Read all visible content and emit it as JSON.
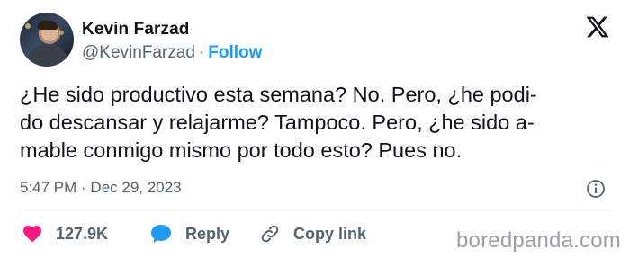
{
  "author": {
    "name": "Kevin Farzad",
    "handle": "@KevinFarzad",
    "separator": "·",
    "follow_label": "Follow"
  },
  "tweet": {
    "text": "¿He sido productivo esta semana? No. Pero, ¿he podi-\ndo descansar y relajarme? Tampoco. Pero, ¿he sido a-\nmable conmigo mismo por todo esto? Pues no.",
    "timestamp": "5:47 PM · Dec 29, 2023"
  },
  "actions": {
    "likes_count": "127.9K",
    "reply_label": "Reply",
    "copy_link_label": "Copy link"
  },
  "icons": {
    "platform_logo": "x-logo-icon",
    "info": "info-icon",
    "like": "heart-icon",
    "reply": "speech-bubble-icon",
    "copy_link": "link-icon"
  },
  "colors": {
    "accent": "#1d9bf0",
    "like": "#f91880",
    "secondary_text": "#536471",
    "primary_text": "#0f1419"
  },
  "watermark": "boredpanda.com"
}
